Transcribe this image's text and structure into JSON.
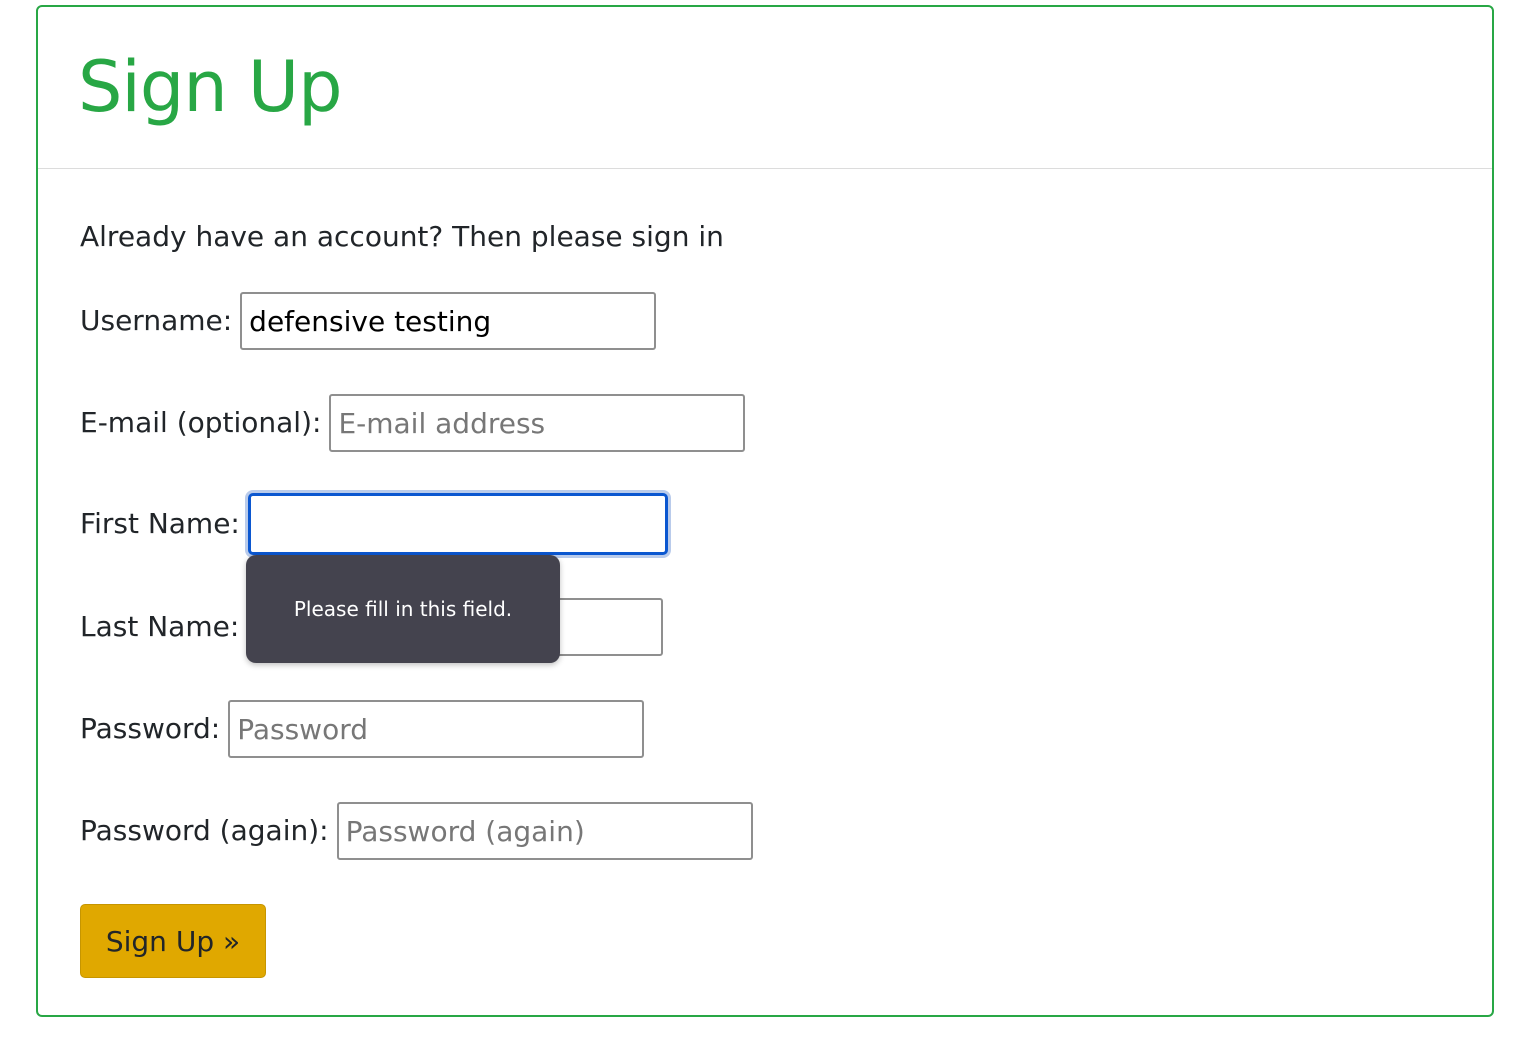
{
  "header": {
    "title": "Sign Up"
  },
  "intro_text": "Already have an account? Then please sign in",
  "form": {
    "username": {
      "label": "Username:",
      "value": "defensive testing",
      "placeholder": ""
    },
    "email": {
      "label": "E-mail (optional):",
      "value": "",
      "placeholder": "E-mail address"
    },
    "first_name": {
      "label": "First Name:",
      "value": "",
      "placeholder": ""
    },
    "last_name": {
      "label": "Last Name:",
      "value": "",
      "placeholder": ""
    },
    "password": {
      "label": "Password:",
      "value": "",
      "placeholder": "Password"
    },
    "password_again": {
      "label": "Password (again):",
      "value": "",
      "placeholder": "Password (again)"
    },
    "submit_label": "Sign Up »"
  },
  "validation_tooltip": "Please fill in this field.",
  "colors": {
    "accent": "#28a745",
    "button": "#e0a800",
    "focus": "#0b57d0",
    "tooltip_bg": "#44434e"
  }
}
